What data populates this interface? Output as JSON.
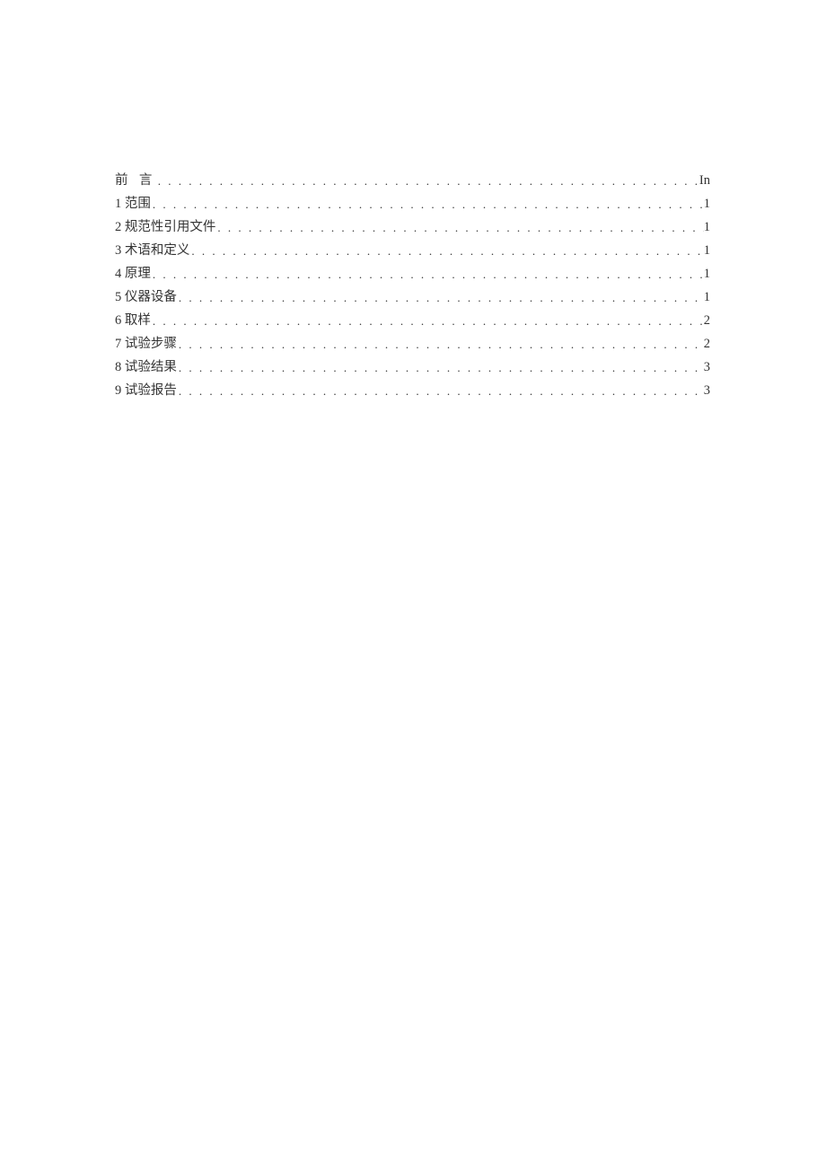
{
  "toc": {
    "entries": [
      {
        "num": "",
        "title": "前 言",
        "page": "In",
        "spaced": true
      },
      {
        "num": "1",
        "title": "范围",
        "page": "1",
        "spaced": false
      },
      {
        "num": "2",
        "title": "规范性引用文件",
        "page": "1",
        "spaced": false
      },
      {
        "num": "3",
        "title": "术语和定义",
        "page": "1",
        "spaced": false
      },
      {
        "num": "4",
        "title": "原理",
        "page": "1",
        "spaced": false
      },
      {
        "num": "5",
        "title": "仪器设备",
        "page": "1",
        "spaced": false
      },
      {
        "num": "6",
        "title": "取样",
        "page": "2",
        "spaced": false
      },
      {
        "num": "7",
        "title": "试验步骤",
        "page": "2",
        "spaced": false
      },
      {
        "num": "8",
        "title": "试验结果",
        "page": "3",
        "spaced": false
      },
      {
        "num": "9",
        "title": "试验报告",
        "page": "3",
        "spaced": false
      }
    ]
  }
}
